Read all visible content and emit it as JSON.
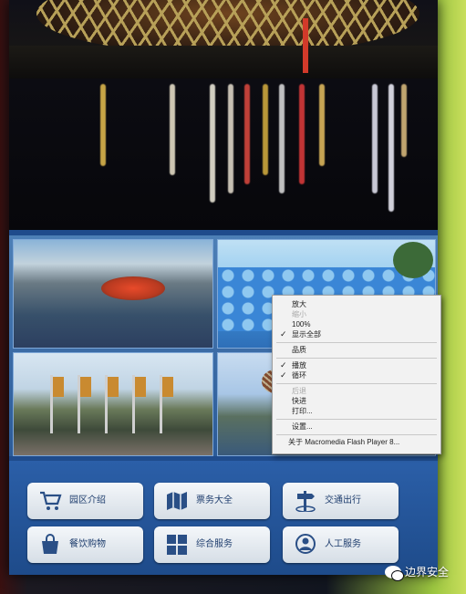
{
  "context_menu": {
    "items": [
      {
        "label": "放大",
        "disabled": false,
        "checked": false
      },
      {
        "label": "缩小",
        "disabled": true,
        "checked": false
      },
      {
        "label": "100%",
        "disabled": false,
        "checked": false
      },
      {
        "label": "显示全部",
        "disabled": false,
        "checked": true
      },
      {
        "label": "品质",
        "disabled": false,
        "checked": false
      },
      {
        "label": "播放",
        "disabled": false,
        "checked": true
      },
      {
        "label": "循环",
        "disabled": false,
        "checked": true
      },
      {
        "label": "后退",
        "disabled": true,
        "checked": false
      },
      {
        "label": "快进",
        "disabled": false,
        "checked": false
      },
      {
        "label": "打印...",
        "disabled": false,
        "checked": false
      },
      {
        "label": "设置...",
        "disabled": false,
        "checked": false
      },
      {
        "label": "关于 Macromedia Flash Player 8...",
        "disabled": false,
        "checked": false
      }
    ],
    "check_glyph": "✓"
  },
  "buttons": [
    {
      "label": "园区介绍",
      "icon": "shopping-cart-icon"
    },
    {
      "label": "票务大全",
      "icon": "map-icon"
    },
    {
      "label": "交通出行",
      "icon": "signpost-icon"
    },
    {
      "label": "餐饮购物",
      "icon": "shopping-bag-icon"
    },
    {
      "label": "综合服务",
      "icon": "grid-icon"
    },
    {
      "label": "人工服务",
      "icon": "person-service-icon"
    }
  ],
  "watermark": {
    "text": "边界安全",
    "icon": "wechat-icon"
  },
  "colors": {
    "panel": "#1e4b8a",
    "button_text": "#1f3e6e",
    "menu_bg": "#f2f2f2"
  }
}
